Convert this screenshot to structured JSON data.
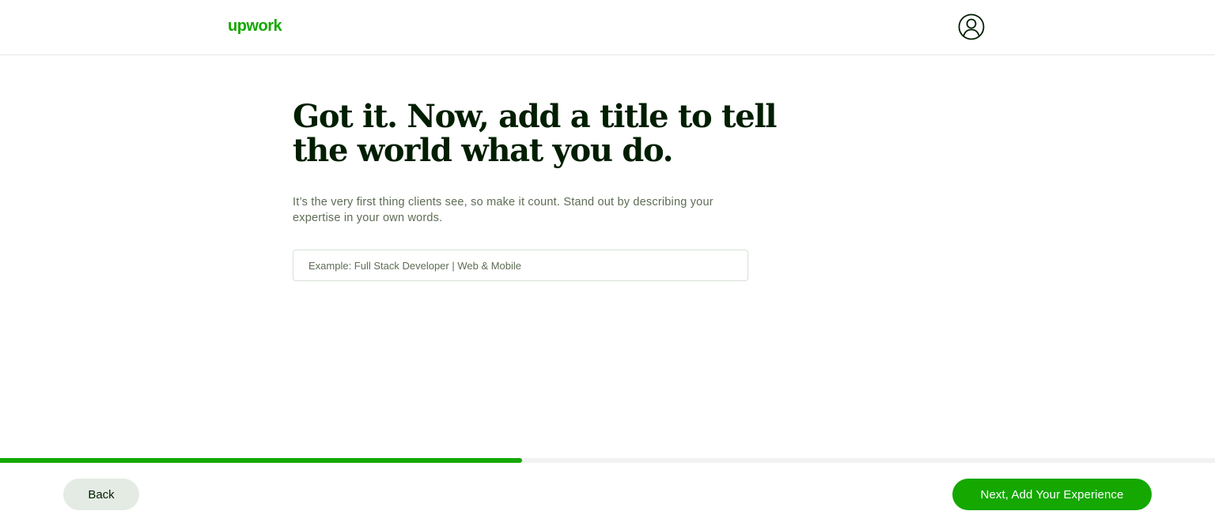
{
  "header": {
    "logo_text": "upwork",
    "avatar_icon": "user-circle-icon"
  },
  "main": {
    "title": "Got it. Now, add a title to tell the world what you do.",
    "subtitle": "It’s the very first thing clients see, so make it count. Stand out by describing your expertise in your own words.",
    "title_input": {
      "value": "",
      "placeholder": "Example: Full Stack Developer | Web & Mobile"
    }
  },
  "progress": {
    "fraction": 0.43
  },
  "footer": {
    "back_label": "Back",
    "next_label": "Next, Add Your Experience"
  },
  "colors": {
    "brand_green": "#14a800",
    "heading": "#001e00",
    "muted_text": "#5e6d55",
    "back_button_bg": "#e4ebe4",
    "progress_track": "#f2f2f2"
  }
}
